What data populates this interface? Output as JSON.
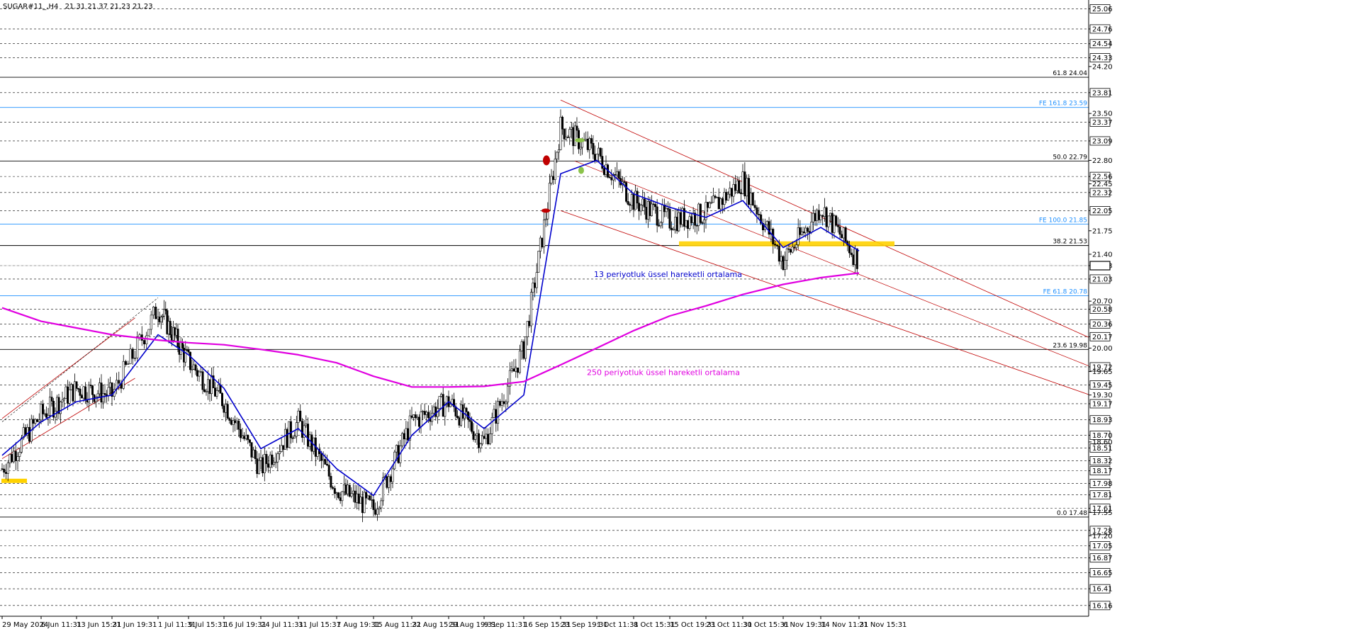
{
  "header": {
    "symbol": "SUGAR#11_,H4",
    "ohlc": "21.31 21.37 21.23 21.23"
  },
  "colors": {
    "candles": "#000000",
    "ema13": "#0000cc",
    "ema250": "#e000e0",
    "channel": "#c00000",
    "fib": "#000000",
    "fe": "#1e90ff",
    "support_zone": "#ffd200",
    "marker_red": "#c00000",
    "marker_green": "#8bc34a"
  },
  "chart_data": {
    "type": "line",
    "title": "",
    "xlabel": "",
    "ylabel": "",
    "ylim": [
      16.0,
      25.15
    ],
    "grid": true,
    "x_ticks": [
      "29 May 2024",
      "6 Jun 11:31",
      "13 Jun 15:31",
      "21 Jun 19:31",
      "1 Jul 11:31",
      "9 Jul 15:31",
      "16 Jul 19:31",
      "24 Jul 11:31",
      "31 Jul 15:31",
      "7 Aug 19:31",
      "15 Aug 11:31",
      "22 Aug 15:31",
      "29 Aug 19:31",
      "9 Sep 11:31",
      "16 Sep 15:31",
      "23 Sep 19:31",
      "1 Oct 11:31",
      "8 Oct 15:31",
      "15 Oct 19:31",
      "23 Oct 11:31",
      "30 Oct 15:31",
      "6 Nov 19:31",
      "14 Nov 11:31",
      "21 Nov 15:31"
    ],
    "y_ticks_boxed": [
      "25.06",
      "24.76",
      "24.54",
      "24.33",
      "23.81",
      "23.37",
      "23.09",
      "22.56",
      "22.32",
      "22.05",
      "21.23",
      "21.03",
      "20.58",
      "20.36",
      "20.17",
      "19.72",
      "19.45",
      "19.17",
      "18.93",
      "18.70",
      "18.51",
      "18.32",
      "18.17",
      "17.98",
      "17.81",
      "17.61",
      "17.28",
      "17.05",
      "16.87",
      "16.65",
      "16.41",
      "16.16"
    ],
    "y_ticks_plain": [
      "24.20",
      "23.50",
      "22.80",
      "22.45",
      "21.75",
      "21.40",
      "20.70",
      "20.00",
      "19.65",
      "19.30",
      "18.60",
      "17.55",
      "17.20"
    ],
    "current_price": "21.23",
    "series": [
      {
        "type": "candlestick_trace",
        "x": [
          "29 May 2024",
          "6 Jun 11:31",
          "13 Jun 15:31",
          "21 Jun 19:31",
          "1 Jul 11:31",
          "9 Jul 15:31",
          "16 Jul 19:31",
          "24 Jul 11:31",
          "31 Jul 15:31",
          "7 Aug 19:31",
          "15 Aug 11:31",
          "22 Aug 15:31",
          "29 Aug 19:31",
          "9 Sep 11:31",
          "16 Sep 15:31",
          "23 Sep 19:31",
          "1 Oct 11:31",
          "8 Oct 15:31",
          "15 Oct 19:31",
          "23 Oct 11:31",
          "30 Oct 15:31",
          "6 Nov 19:31",
          "14 Nov 11:31",
          "21 Nov 15:31"
        ],
        "values": [
          18.2,
          19.0,
          19.4,
          19.3,
          20.6,
          19.8,
          19.2,
          18.2,
          18.9,
          17.9,
          17.6,
          18.9,
          19.2,
          18.6,
          20.0,
          23.3,
          22.9,
          22.2,
          21.9,
          22.0,
          22.5,
          21.3,
          22.1,
          21.3
        ]
      },
      {
        "name": "13 periyotluk üssel hareketli ortalama",
        "x": [
          "29 May 2024",
          "6 Jun 11:31",
          "13 Jun 15:31",
          "21 Jun 19:31",
          "1 Jul 11:31",
          "9 Jul 15:31",
          "16 Jul 19:31",
          "24 Jul 11:31",
          "31 Jul 15:31",
          "7 Aug 19:31",
          "15 Aug 11:31",
          "22 Aug 15:31",
          "29 Aug 19:31",
          "9 Sep 11:31",
          "16 Sep 15:31",
          "23 Sep 19:31",
          "1 Oct 11:31",
          "8 Oct 15:31",
          "15 Oct 19:31",
          "23 Oct 11:31",
          "30 Oct 15:31",
          "6 Nov 19:31",
          "14 Nov 11:31",
          "21 Nov 15:31"
        ],
        "values": [
          18.4,
          18.9,
          19.2,
          19.3,
          20.2,
          19.9,
          19.4,
          18.5,
          18.8,
          18.2,
          17.8,
          18.7,
          19.2,
          18.8,
          19.3,
          22.6,
          22.8,
          22.3,
          22.1,
          21.95,
          22.2,
          21.5,
          21.8,
          21.45
        ]
      },
      {
        "name": "250 periyotluk üssel hareketli ortalama",
        "x": [
          "29 May 2024",
          "6 Jun 11:31",
          "13 Jun 15:31",
          "21 Jun 19:31",
          "1 Jul 11:31",
          "9 Jul 15:31",
          "16 Jul 19:31",
          "24 Jul 11:31",
          "31 Jul 15:31",
          "7 Aug 19:31",
          "15 Aug 11:31",
          "22 Aug 15:31",
          "29 Aug 19:31",
          "9 Sep 11:31",
          "16 Sep 15:31",
          "23 Sep 19:31",
          "1 Oct 11:31",
          "8 Oct 15:31",
          "15 Oct 19:31",
          "23 Oct 11:31",
          "30 Oct 15:31",
          "6 Nov 19:31",
          "14 Nov 11:31",
          "21 Nov 15:31"
        ],
        "values": [
          20.6,
          20.4,
          20.3,
          20.2,
          20.12,
          20.08,
          20.05,
          19.98,
          19.9,
          19.78,
          19.58,
          19.42,
          19.42,
          19.43,
          19.5,
          19.75,
          20.0,
          20.26,
          20.48,
          20.63,
          20.8,
          20.95,
          21.05,
          21.12
        ]
      }
    ],
    "annotations": [
      {
        "label": "61.8 24.04",
        "y": 24.04,
        "style": "fib"
      },
      {
        "label": "FE 161.8 23.59",
        "y": 23.59,
        "style": "fe"
      },
      {
        "label": "50.0 22.79",
        "y": 22.79,
        "style": "fib"
      },
      {
        "label": "FE 100.0 21.85",
        "y": 21.85,
        "style": "fe"
      },
      {
        "label": "38.2 21.53",
        "y": 21.53,
        "style": "fib"
      },
      {
        "label": "FE 61.8 20.78",
        "y": 20.78,
        "style": "fe"
      },
      {
        "label": "23.6 19.98",
        "y": 19.98,
        "style": "fib"
      },
      {
        "label": "0.0 17.48",
        "y": 17.48,
        "style": "fib"
      }
    ],
    "support_zone": {
      "y": 21.55
    },
    "channel": {
      "upper": {
        "from": [
          "23 Sep 19:31",
          23.7
        ],
        "to": [
          "21 Nov 15:31",
          21.7
        ]
      },
      "lower": {
        "from": [
          "23 Sep 19:31",
          22.05
        ],
        "to": [
          "21 Nov 15:31",
          20.5
        ]
      }
    },
    "ema_labels": [
      {
        "text": "13 periyotluk üssel hareketli ortalama",
        "series": "ema13"
      },
      {
        "text": "250 periyotluk üssel hareketli ortalama",
        "series": "ema250"
      }
    ]
  }
}
